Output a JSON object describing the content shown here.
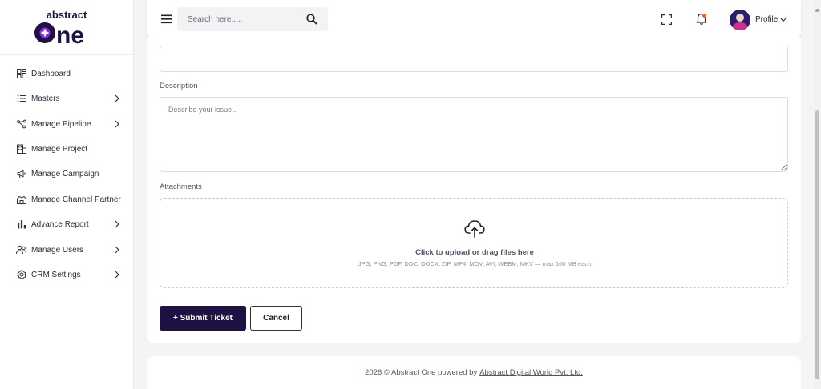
{
  "brand": {
    "logo_top": "abstract",
    "logo_main": "one",
    "colors": {
      "primary": "#1d1242",
      "accent": "#8b2be2",
      "notification": "#f7631e"
    }
  },
  "sidebar": {
    "items": [
      {
        "label": "Dashboard",
        "icon": "dashboard-grid-icon",
        "has_submenu": false
      },
      {
        "label": "Masters",
        "icon": "list-icon",
        "has_submenu": true
      },
      {
        "label": "Manage Pipeline",
        "icon": "pipeline-icon",
        "has_submenu": true
      },
      {
        "label": "Manage Project",
        "icon": "building-icon",
        "has_submenu": false
      },
      {
        "label": "Manage Campaign",
        "icon": "megaphone-icon",
        "has_submenu": false
      },
      {
        "label": "Manage Channel Partner",
        "icon": "handshake-icon",
        "has_submenu": false
      },
      {
        "label": "Advance Report",
        "icon": "bar-chart-icon",
        "has_submenu": true
      },
      {
        "label": "Manage Users",
        "icon": "users-icon",
        "has_submenu": true
      },
      {
        "label": "CRM Settings",
        "icon": "gear-icon",
        "has_submenu": true
      }
    ]
  },
  "header": {
    "search_placeholder": "Search here.....",
    "profile_label": "Profile"
  },
  "form": {
    "description_label": "Description",
    "description_placeholder": "Describe your issue...",
    "attachments_label": "Attachments",
    "upload_title": "Click to upload or drag files here",
    "upload_hint": "JPG, PNG, PDF, DOC, DOCX, ZIP, MP4, MOV, AVI, WEBM, MKV — max 100 MB each",
    "submit_label": "+ Submit Ticket",
    "cancel_label": "Cancel"
  },
  "footer": {
    "text": "2026 © Abstract One powered by",
    "link": "Abstract Digital World Pvt. Ltd."
  }
}
